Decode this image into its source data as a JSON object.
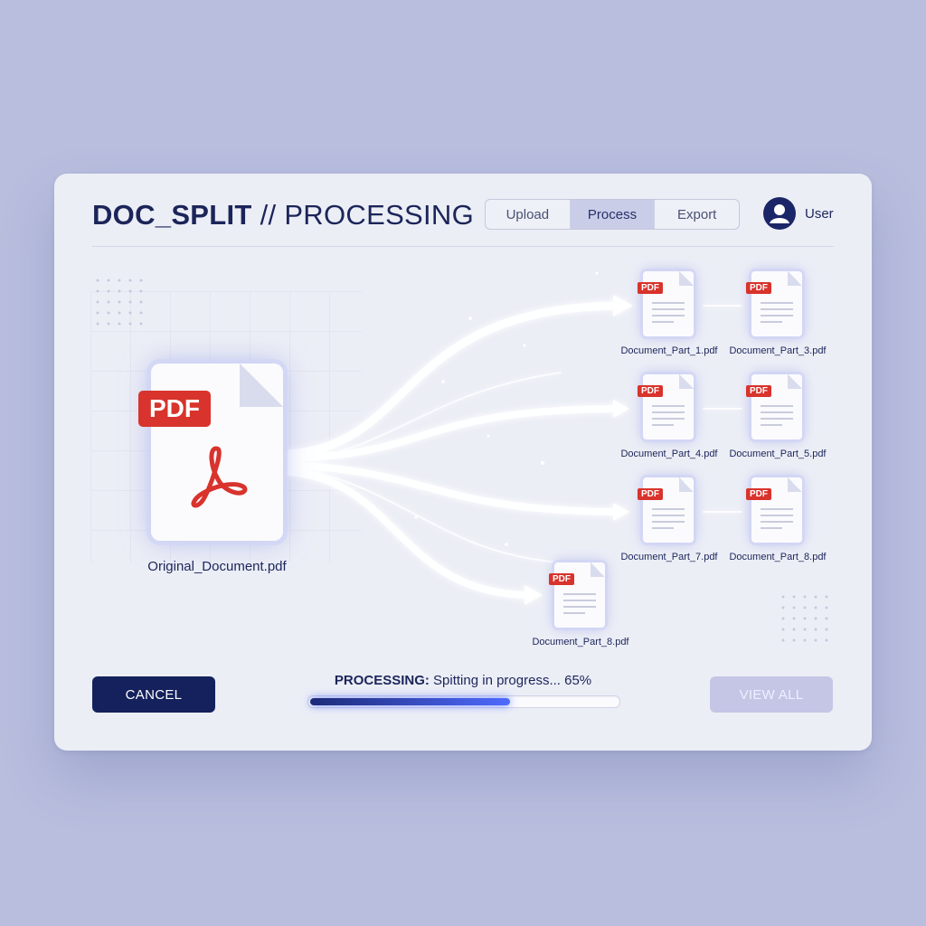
{
  "header": {
    "title_bold": "DOC_SPLIT",
    "title_sep": " // ",
    "title_thin": "PROCESSING"
  },
  "tabs": [
    {
      "label": "Upload",
      "active": false
    },
    {
      "label": "Process",
      "active": true
    },
    {
      "label": "Export",
      "active": false
    }
  ],
  "user": {
    "label": "User",
    "icon": "user-avatar-icon"
  },
  "source": {
    "badge": "PDF",
    "filename": "Original_Document.pdf",
    "icon": "acrobat-logo-icon"
  },
  "parts": [
    {
      "badge": "PDF",
      "name": "Document_Part_1.pdf"
    },
    {
      "badge": "PDF",
      "name": "Document_Part_3.pdf"
    },
    {
      "badge": "PDF",
      "name": "Document_Part_4.pdf"
    },
    {
      "badge": "PDF",
      "name": "Document_Part_5.pdf"
    },
    {
      "badge": "PDF",
      "name": "Document_Part_7.pdf"
    },
    {
      "badge": "PDF",
      "name": "Document_Part_8.pdf"
    },
    {
      "badge": "PDF",
      "name": "Document_Part_8.pdf"
    }
  ],
  "footer": {
    "cancel_label": "CANCEL",
    "view_all_label": "VIEW ALL",
    "status_label": "PROCESSING:",
    "status_text": " Spitting in progress... 65%",
    "progress_fraction": 0.65
  },
  "colors": {
    "accent": "#14215c",
    "pdf_red": "#d8332c",
    "progress": "#4f6bff"
  }
}
